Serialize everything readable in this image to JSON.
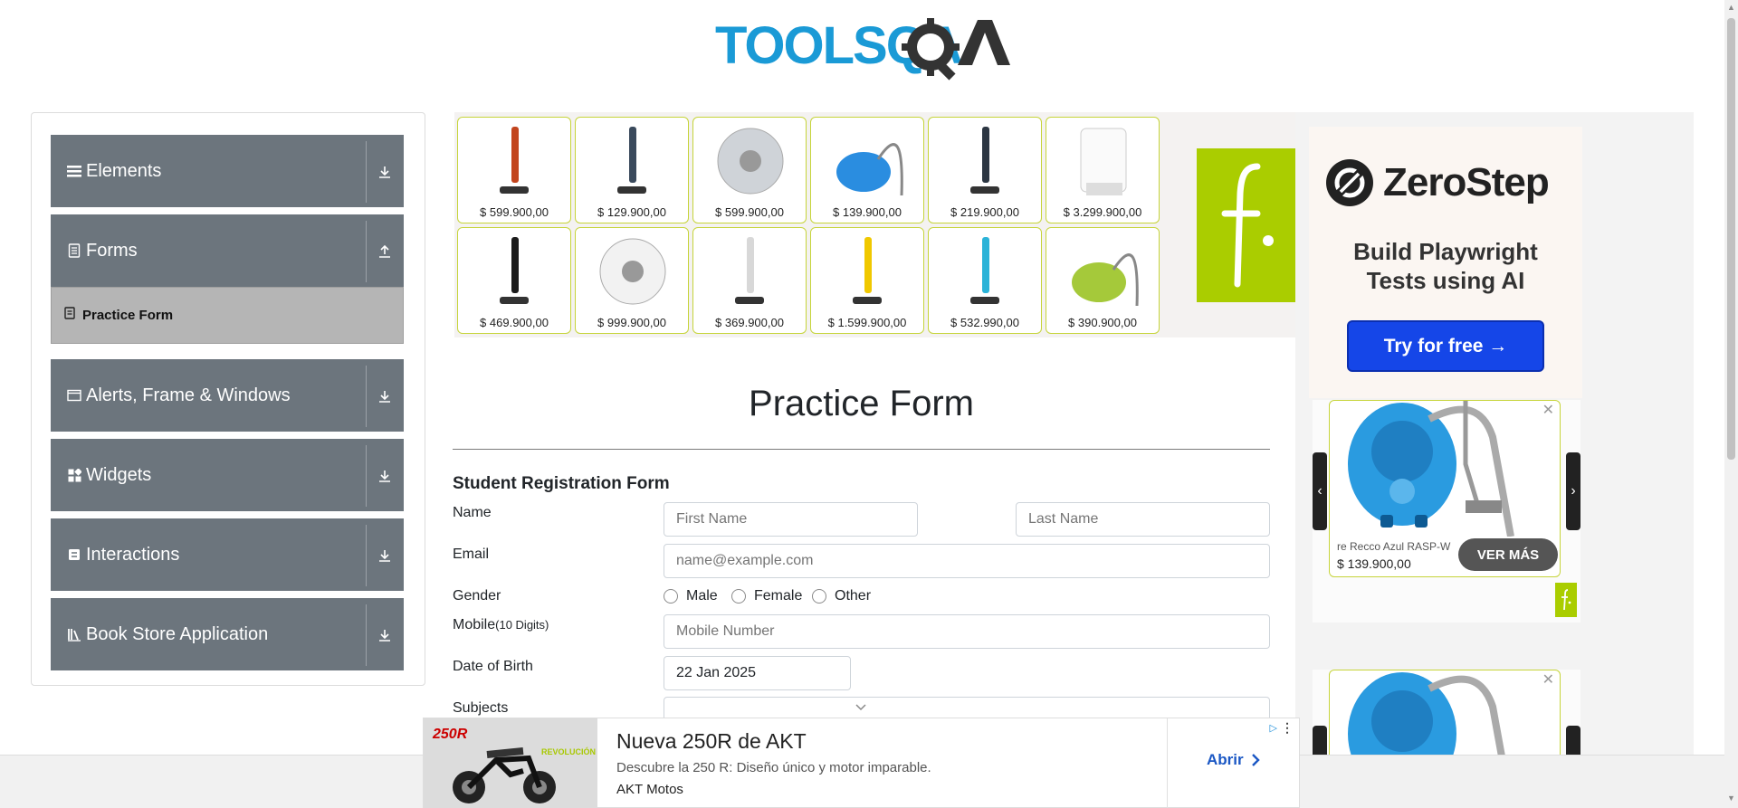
{
  "header": {
    "logo_text": "TOOLSQA"
  },
  "sidebar": {
    "groups": [
      {
        "label": "Elements",
        "icon": "menu-icon"
      },
      {
        "label": "Forms",
        "icon": "document-icon"
      },
      {
        "label": "Alerts, Frame & Windows",
        "icon": "window-icon"
      },
      {
        "label": "Widgets",
        "icon": "widgets-icon"
      },
      {
        "label": "Interactions",
        "icon": "interactions-icon"
      },
      {
        "label": "Book Store Application",
        "icon": "library-icon"
      }
    ],
    "active_item": "Practice Form"
  },
  "product_ads": [
    {
      "price": "$ 599.900,00"
    },
    {
      "price": "$ 129.900,00"
    },
    {
      "price": "$ 599.900,00"
    },
    {
      "price": "$ 139.900,00"
    },
    {
      "price": "$ 219.900,00"
    },
    {
      "price": "$ 3.299.900,00"
    },
    {
      "price": "$ 469.900,00"
    },
    {
      "price": "$ 999.900,00"
    },
    {
      "price": "$ 369.900,00"
    },
    {
      "price": "$ 1.599.900,00"
    },
    {
      "price": "$ 532.990,00"
    },
    {
      "price": "$ 390.900,00"
    }
  ],
  "zerostep": {
    "name": "ZeroStep",
    "tagline_1": "Build Playwright",
    "tagline_2": "Tests using AI",
    "cta": "Try for free →"
  },
  "carousel_ad": {
    "title": "re Recco Azul RASP-W",
    "price": "$ 139.900,00",
    "button": "VER MÁS"
  },
  "form": {
    "page_title": "Practice Form",
    "form_title": "Student Registration Form",
    "name_label": "Name",
    "first_name_placeholder": "First Name",
    "last_name_placeholder": "Last Name",
    "email_label": "Email",
    "email_placeholder": "name@example.com",
    "gender_label": "Gender",
    "gender_options": [
      "Male",
      "Female",
      "Other"
    ],
    "mobile_label": "Mobile",
    "mobile_hint": "(10 Digits)",
    "mobile_placeholder": "Mobile Number",
    "dob_label": "Date of Birth",
    "dob_value": "22 Jan 2025",
    "subjects_label": "Subjects"
  },
  "bottom_ad": {
    "image_text_1": "250R",
    "image_text_2": "REVOLUCIÓN SOBRE EL ASFALTO",
    "title": "Nueva 250R de AKT",
    "description": "Descubre la 250 R: Diseño único y motor imparable.",
    "advertiser": "AKT Motos",
    "cta": "Abrir",
    "ad_badge": "▷"
  },
  "colors": {
    "accent": "#6c757d",
    "active": "#b5b5b5",
    "brand_blue": "#1a9ad6",
    "falabella": "#aacd00",
    "zerostep_btn": "#1546e8"
  }
}
